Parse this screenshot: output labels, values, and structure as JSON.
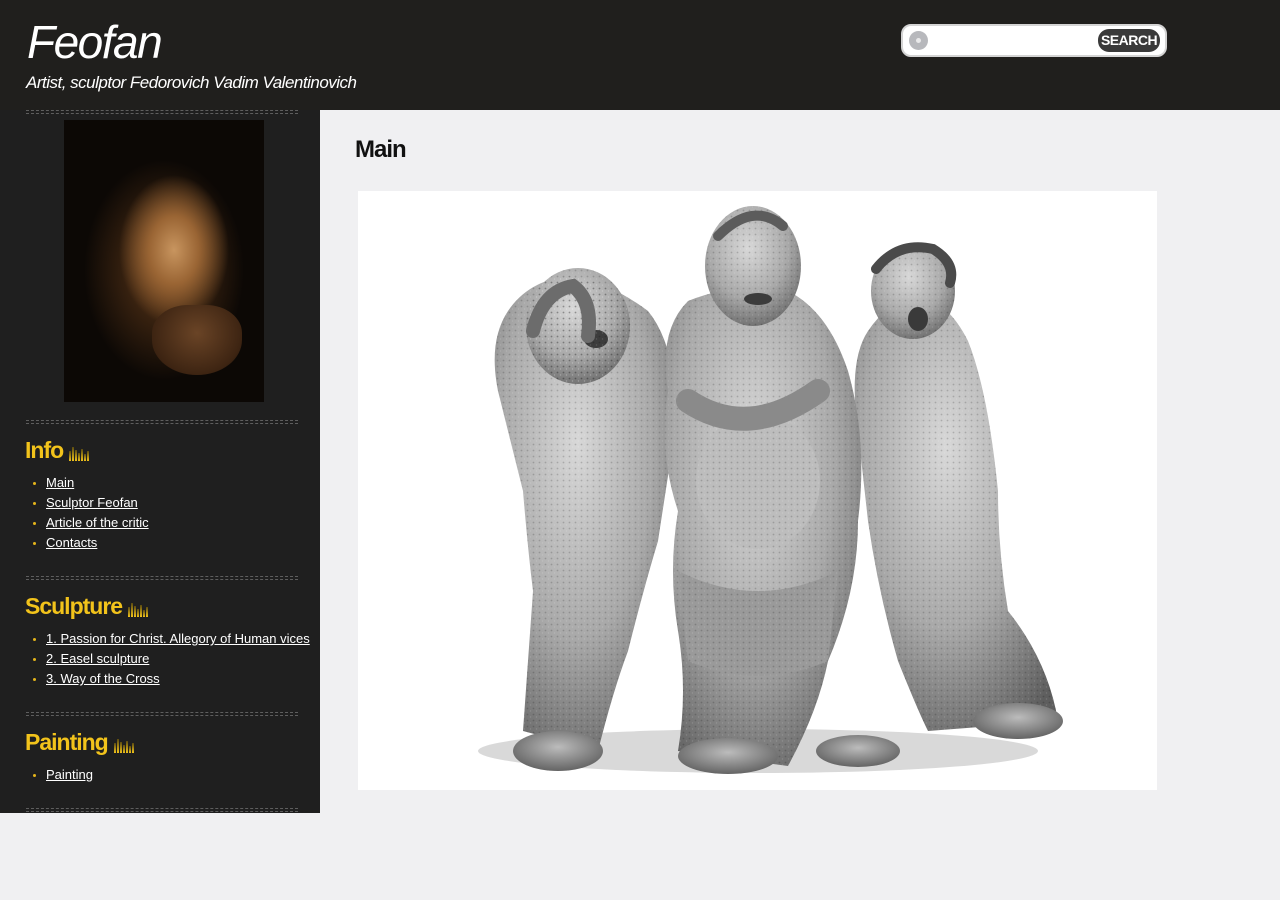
{
  "header": {
    "title": "Feofan",
    "subtitle": "Artist, sculptor Fedorovich Vadim Valentinovich",
    "search": {
      "value": "",
      "placeholder": "",
      "button_label": "SEARCH"
    }
  },
  "sidebar": {
    "sections": [
      {
        "title": "Info",
        "items": [
          "Main",
          "Sculptor Feofan",
          "Article of the critic",
          "Contacts"
        ]
      },
      {
        "title": "Sculpture",
        "items": [
          "1. Passion for Christ. Allegory of Human vices",
          "2. Easel sculpture",
          "3. Way of the Cross"
        ]
      },
      {
        "title": "Painting",
        "items": [
          "Painting"
        ]
      }
    ]
  },
  "main": {
    "title": "Main"
  },
  "colors": {
    "header_bg": "#201f1d",
    "sidebar_bg": "#1f1f1f",
    "accent": "#f2c31b",
    "page_bg": "#f0f0f2"
  },
  "icons": {
    "search": "search-icon",
    "section": "equalizer-bars-icon"
  }
}
